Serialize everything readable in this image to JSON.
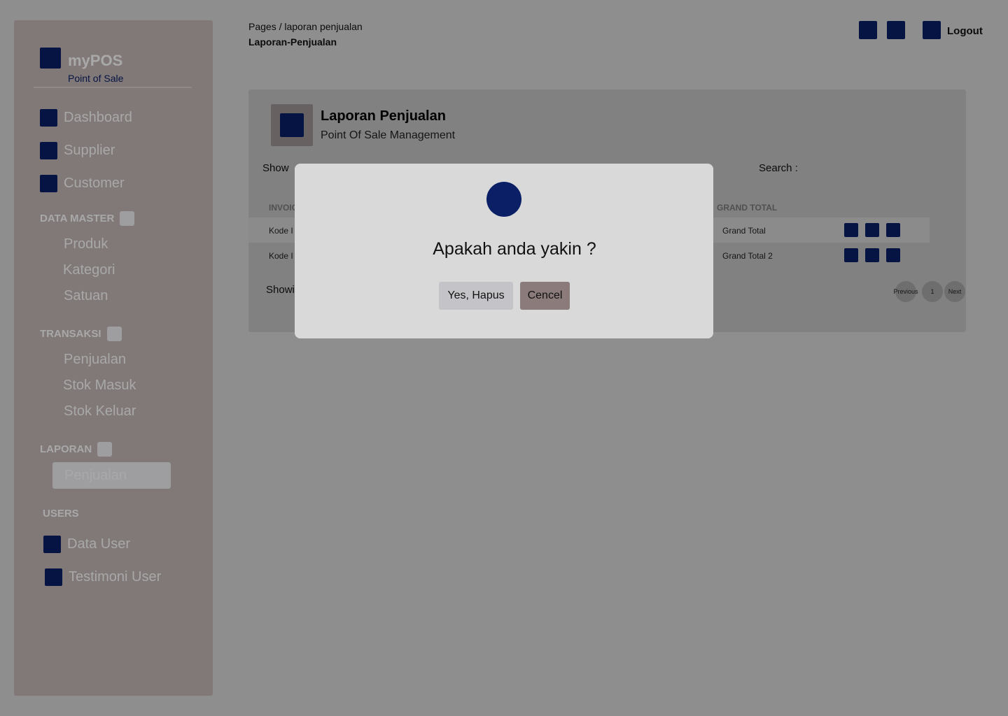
{
  "sidebar": {
    "brand_title": "myPOS",
    "brand_subtitle": "Point of Sale",
    "main_items": [
      {
        "label": "Dashboard",
        "icon": "dashboard-icon"
      },
      {
        "label": "Supplier",
        "icon": "supplier-icon"
      },
      {
        "label": "Customer",
        "icon": "customer-icon"
      }
    ],
    "data_master": {
      "title": "DATA MASTER",
      "items": [
        "Produk",
        "Kategori",
        "Satuan"
      ]
    },
    "transaksi": {
      "title": "TRANSAKSI",
      "items": [
        "Penjualan",
        "Stok Masuk",
        "Stok Keluar"
      ]
    },
    "laporan": {
      "title": "LAPORAN",
      "items": [
        "Penjualan"
      ],
      "active": "Penjualan"
    },
    "users": {
      "title": "USERS",
      "items": [
        {
          "label": "Data User",
          "icon": "user-icon"
        },
        {
          "label": "Testimoni User",
          "icon": "testimoni-icon"
        }
      ]
    }
  },
  "header": {
    "breadcrumb": "Pages / laporan penjualan",
    "page_subtitle": "Laporan-Penjualan",
    "logout_label": "Logout"
  },
  "card": {
    "title": "Laporan Penjualan",
    "subtitle": "Point Of Sale Management",
    "show_label": "Show",
    "search_label": "Search :",
    "columns": {
      "invoice": "INVOIC",
      "grand_total": "GRAND TOTAL"
    },
    "rows": [
      {
        "invoice": "Kode I",
        "grand_total": "Grand Total"
      },
      {
        "invoice": "Kode I",
        "grand_total": "Grand Total 2"
      }
    ],
    "showing_label": "Showi",
    "pagination": {
      "previous": "Previous",
      "page": "1",
      "next": "Next"
    }
  },
  "modal": {
    "message": "Apakah anda yakin ?",
    "confirm_label": "Yes, Hapus",
    "cancel_label": "Cencel"
  },
  "colors": {
    "accent": "#0a1f66",
    "sidebar_bg": "#c4b6b6",
    "card_bg": "#c4c4c4",
    "modal_bg": "#d9d9d9",
    "cancel_bg": "#8b7b7b"
  }
}
